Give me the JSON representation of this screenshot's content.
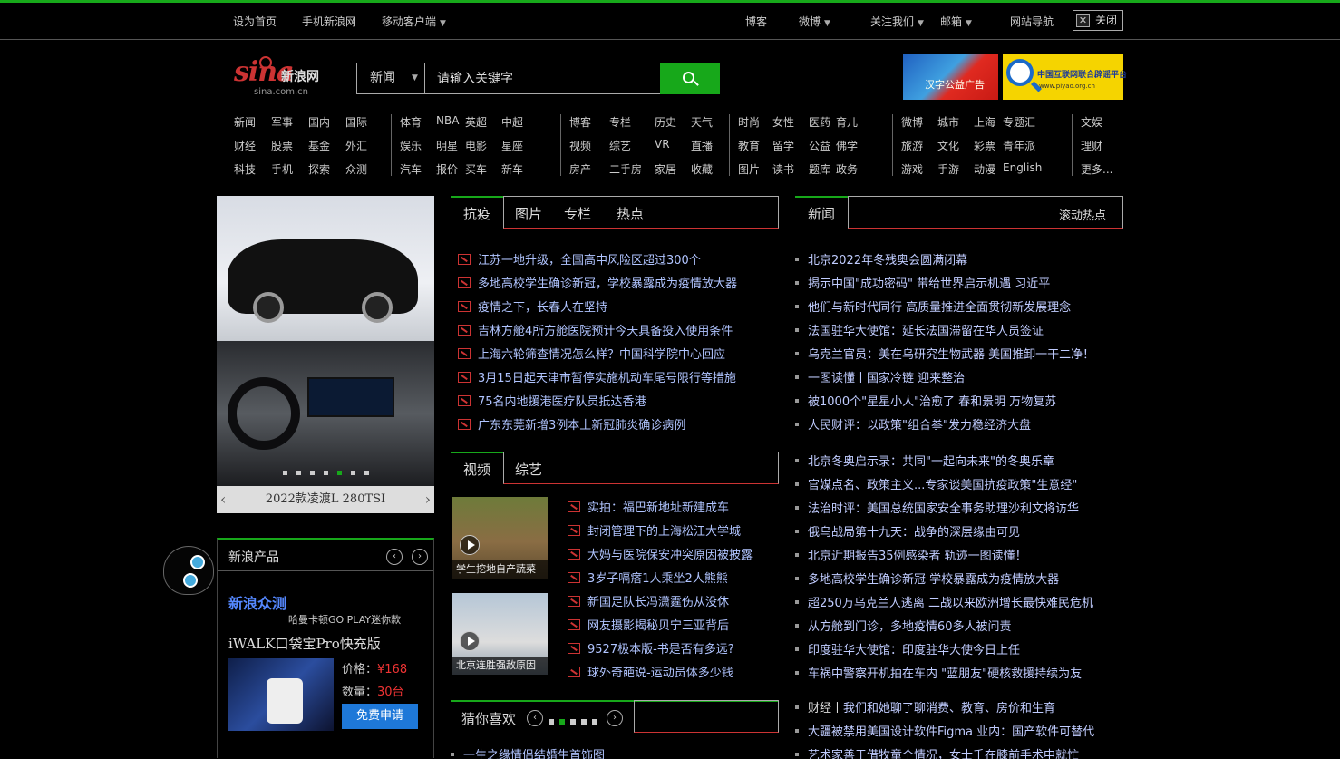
{
  "topbar": {
    "home": "设为首页",
    "mobile_sina": "手机新浪网",
    "mobile_client": "移动客户端",
    "blog": "博客",
    "weibo": "微博",
    "follow": "关注我们",
    "mail": "邮箱",
    "site_nav": "网站导航",
    "close": "关闭"
  },
  "logo": {
    "mark": "sina",
    "name": "新浪网",
    "domain": "sina.com.cn"
  },
  "search": {
    "category": "新闻",
    "placeholder": "请输入关键字"
  },
  "ads": {
    "ad1_text": "汉字公益广告",
    "ad2_title": "中国互联网联合辟谣平台",
    "ad2_url": "www.piyao.org.cn"
  },
  "nav": {
    "groups": [
      {
        "rows": [
          [
            "新闻",
            "军事",
            "国内",
            "国际"
          ],
          [
            "财经",
            "股票",
            "基金",
            "外汇"
          ],
          [
            "科技",
            "手机",
            "探索",
            "众测"
          ]
        ]
      },
      {
        "rows": [
          [
            "体育",
            "NBA",
            "英超",
            "中超"
          ],
          [
            "娱乐",
            "明星",
            "电影",
            "星座"
          ],
          [
            "汽车",
            "报价",
            "买车",
            "新车"
          ]
        ]
      },
      {
        "rows": [
          [
            "博客",
            "专栏",
            "历史",
            "天气"
          ],
          [
            "视频",
            "综艺",
            "VR",
            "直播"
          ],
          [
            "房产",
            "二手房",
            "家居",
            "收藏"
          ]
        ]
      },
      {
        "rows": [
          [
            "时尚",
            "女性",
            "医药",
            "育儿"
          ],
          [
            "教育",
            "留学",
            "公益",
            "佛学"
          ],
          [
            "图片",
            "读书",
            "题库",
            "政务"
          ]
        ]
      },
      {
        "rows": [
          [
            "微博",
            "城市",
            "上海",
            "专题汇"
          ],
          [
            "旅游",
            "文化",
            "彩票",
            "青年派"
          ],
          [
            "游戏",
            "手游",
            "动漫",
            "English"
          ]
        ]
      },
      {
        "rows": [
          [
            "文娱"
          ],
          [
            "理财"
          ],
          [
            "更多..."
          ]
        ]
      }
    ]
  },
  "slider": {
    "caption": "2022款凌渡L 280TSI",
    "prev": "‹",
    "next": "›",
    "dot_count": 7,
    "active_dot": 4
  },
  "products": {
    "title": "新浪产品",
    "brand": "新浪众测",
    "subtitle": "哈曼卡顿GO PLAY迷你款",
    "name": "iWALK口袋宝Pro快充版",
    "price_label": "价格：",
    "price": "¥168",
    "qty_label": "数量：",
    "qty": "30台",
    "apply": "免费申请"
  },
  "antiepidemic": {
    "active_tab": "抗疫",
    "tabs": [
      "图片",
      "专栏",
      "热点"
    ],
    "items": [
      "江苏一地升级，全国高中风险区超过300个",
      "多地高校学生确诊新冠，学校暴露成为疫情放大器",
      "疫情之下，长春人在坚持",
      "吉林方舱4所方舱医院预计今天具备投入使用条件",
      "上海六轮筛查情况怎么样？中国科学院中心回应",
      "3月15日起天津市暂停实施机动车尾号限行等措施",
      "75名内地援港医疗队员抵达香港",
      "广东东莞新增3例本土新冠肺炎确诊病例"
    ]
  },
  "video": {
    "active_tab": "视频",
    "tabs": [
      "综艺"
    ],
    "thumbs": [
      {
        "caption": "学生挖地自产蔬菜"
      },
      {
        "caption": "北京连胜强敌原因"
      }
    ],
    "items": [
      "实拍：福巴新地址新建成车",
      "封闭管理下的上海松江大学城",
      "大妈与医院保安冲突原因被披露",
      "3岁子嗝瘩1人乘坐2人熊熊",
      "新国足队长冯潇霆伤从没休",
      "网友摄影揭秘贝宁三亚背后",
      "9527极本版-书是否有多远?",
      "球外奇葩说-运动员体多少钱"
    ]
  },
  "news": {
    "active_tab": "新闻",
    "tabs": [
      "滚动热点"
    ],
    "group1": [
      "北京2022年冬残奥会圆满闭幕",
      "揭示中国\"成功密码\" 带给世界启示机遇 习近平",
      "他们与新时代同行 高质量推进全面贯彻新发展理念",
      "法国驻华大使馆：延长法国滞留在华人员签证",
      "乌克兰官员：美在乌研究生物武器 美国推卸一干二净！",
      "一图读懂丨国家冷链 迎来整治",
      "被1000个\"星星小人\"治愈了 春和景明 万物复苏",
      "人民财评：以政策\"组合拳\"发力稳经济大盘"
    ],
    "group2": [
      "北京冬奥启示录：共同\"一起向未来\"的冬奥乐章",
      "官媒点名、政策主义...专家谈美国抗疫政策\"生意经\"",
      "法治时评：美国总统国家安全事务助理沙利文将访华",
      "俄乌战局第十九天：战争的深层缘由可见",
      "北京近期报告35例感染者 轨迹一图读懂！",
      "多地高校学生确诊新冠 学校暴露成为疫情放大器",
      "超250万乌克兰人逃离 二战以来欧洲增长最快难民危机",
      "从方舱到门诊，多地疫情60多人被问责",
      "印度驻华大使馆：印度驻华大使今日上任",
      "车祸中警察开机拍在车内 \"蓝朋友\"硬核救援持续为友"
    ],
    "group3": [
      {
        "tag": "财经丨",
        "text": "我们和她聊了聊消费、教育、房价和生育"
      },
      {
        "tag": "",
        "text": "大疆被禁用美国设计软件Figma 业内：国产软件可替代"
      },
      {
        "tag": "",
        "text": "艺术家善于借牧童个情况，女士千在膝前手术中就忙"
      }
    ]
  },
  "guess": {
    "title": "猜你喜欢",
    "first_item": "一生之缘情侣结婚生首饰图"
  }
}
